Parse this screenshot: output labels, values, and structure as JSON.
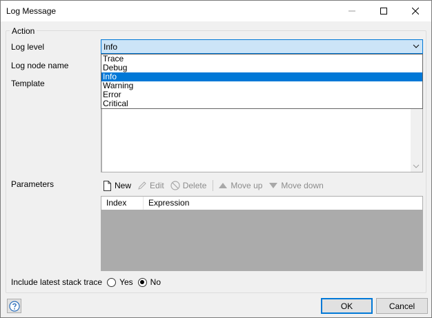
{
  "window": {
    "title": "Log Message",
    "controls": {
      "minimize": "minimize-icon",
      "maximize": "maximize-icon",
      "close": "close-icon"
    }
  },
  "action_group": {
    "label": "Action"
  },
  "log_level": {
    "label": "Log level",
    "value": "Info",
    "options": [
      "Trace",
      "Debug",
      "Info",
      "Warning",
      "Error",
      "Critical"
    ],
    "selected_index": 2
  },
  "log_node_name": {
    "label": "Log node name"
  },
  "template": {
    "label": "Template"
  },
  "parameters": {
    "label": "Parameters",
    "toolbar": {
      "new": "New",
      "edit": "Edit",
      "delete": "Delete",
      "move_up": "Move up",
      "move_down": "Move down"
    },
    "columns": [
      "Index",
      "Expression"
    ]
  },
  "stack_trace": {
    "label": "Include latest stack trace",
    "yes": "Yes",
    "no": "No",
    "selected": "No"
  },
  "footer": {
    "ok": "OK",
    "cancel": "Cancel",
    "help_icon": "help-icon"
  },
  "colors": {
    "accent": "#0078d7",
    "combo_bg": "#cce4f7",
    "grid_bg": "#ababab",
    "dialog_bg": "#f0f0f0"
  }
}
